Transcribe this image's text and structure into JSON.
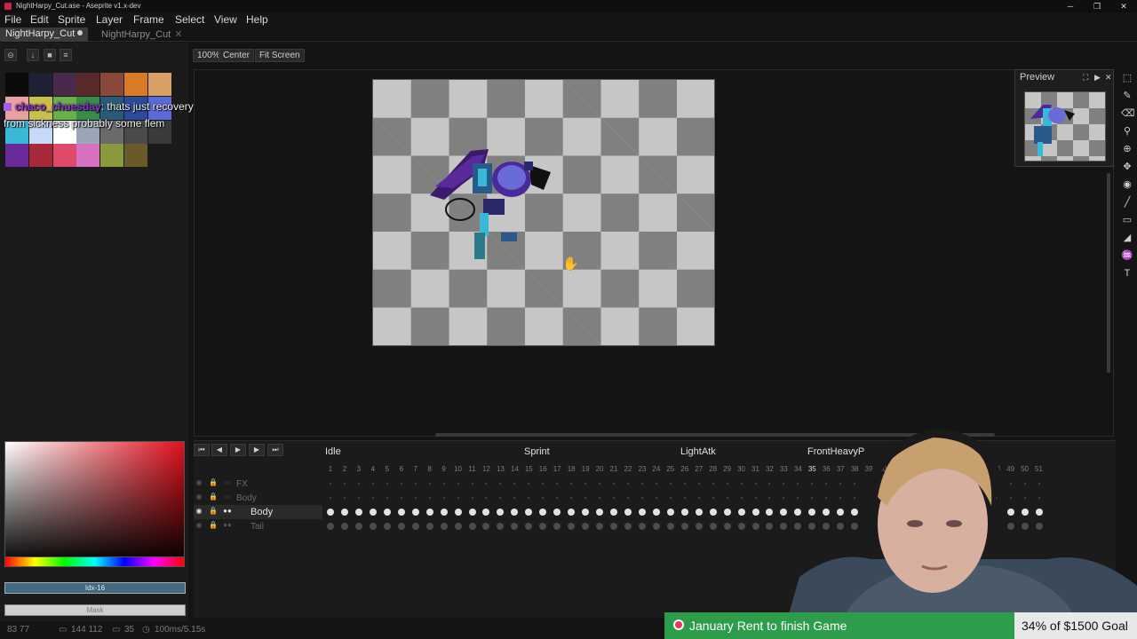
{
  "window": {
    "title": "NightHarpy_Cut.ase - Aseprite v1.x-dev"
  },
  "menu": [
    "File",
    "Edit",
    "Sprite",
    "Layer",
    "Frame",
    "Select",
    "View",
    "Help"
  ],
  "tabs": [
    {
      "label": "NightHarpy_Cut"
    },
    {
      "label": "NightHarpy_Cut"
    }
  ],
  "toolbar": {
    "zoom": "100%",
    "center": "Center",
    "fit": "Fit Screen"
  },
  "chat": {
    "user": "chaco_chuesday",
    "message": ": thats just recovery",
    "message2": "from sickness probably some flem"
  },
  "palette": [
    "#0b0b0b",
    "#1e2033",
    "#4a2a4a",
    "#5a2a2a",
    "#8a4a3a",
    "#d97a26",
    "#d9a066",
    "#e8a0a0",
    "#c9c04a",
    "#6ab04a",
    "#3a8a4a",
    "#2a5a7a",
    "#2a4a9a",
    "#5a6ad8",
    "#3ab8d8",
    "#c8d8f8",
    "#ffffff",
    "#9aa6b8",
    "#6a6a6a",
    "#4a4a4a",
    "#3a3a3a",
    "#6a2a9a",
    "#a82a3a",
    "#e04a6a",
    "#d870c0",
    "#8a9a3a",
    "#6a5a2a"
  ],
  "colorbar": {
    "index": "Idx-16",
    "mask": "Mask"
  },
  "preview": {
    "title": "Preview"
  },
  "timeline": {
    "tags": [
      {
        "label": "Idle"
      },
      {
        "label": "Sprint"
      },
      {
        "label": "LightAtk"
      },
      {
        "label": "FrontHeavyP"
      }
    ],
    "frames_first": 1,
    "frames_last": 51,
    "current_frame": "35",
    "layers": [
      {
        "name": "FX"
      },
      {
        "name": "Body"
      },
      {
        "name": "Body"
      },
      {
        "name": "Tail"
      }
    ]
  },
  "status": {
    "pos": "83 77",
    "size": "144 112",
    "frame": "35",
    "duration": "100ms/5.15s"
  },
  "goal": {
    "text": "January Rent to finish Game",
    "progress": "34% of $1500 Goal"
  }
}
